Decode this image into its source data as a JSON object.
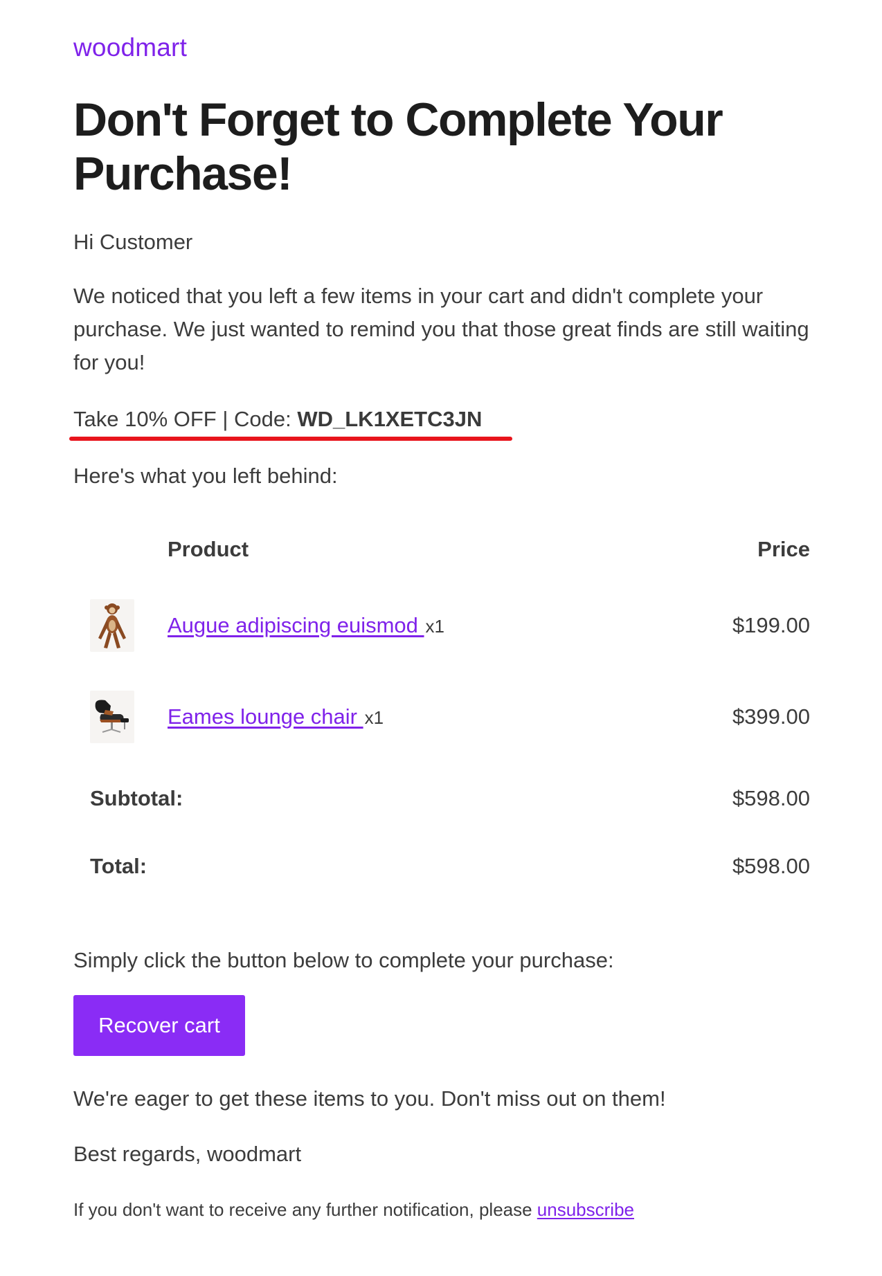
{
  "brand": {
    "name": "woodmart",
    "color": "#7f22ea"
  },
  "email": {
    "title": "Don't Forget to Complete Your Purchase!",
    "greeting": "Hi Customer",
    "intro": "We noticed that you left a few items in your cart and didn't complete your purchase. We just wanted to remind you that those great finds are still waiting for you!",
    "promo": {
      "prefix": "Take 10% OFF | Code: ",
      "code": "WD_LK1XETC3JN",
      "highlight_color": "#e8141c"
    },
    "left_behind": "Here's what you left behind:",
    "table": {
      "product_header": "Product",
      "price_header": "Price",
      "items": [
        {
          "name": "Augue adipiscing euismod ",
          "qty": "x1",
          "price": "$199.00",
          "thumb_icon": "wooden-monkey-figure-icon"
        },
        {
          "name": "Eames lounge chair ",
          "qty": "x1",
          "price": "$399.00",
          "thumb_icon": "lounge-chair-icon"
        }
      ],
      "subtotal_label": "Subtotal:",
      "subtotal_value": "$598.00",
      "total_label": "Total:",
      "total_value": "$598.00"
    },
    "cta_text": "Simply click the button below to complete your purchase:",
    "button_label": "Recover cart",
    "button_color": "#8a2cf5",
    "eager": "We're eager to get these items to you. Don't miss out on them!",
    "regards": "Best regards, woodmart",
    "footer": {
      "text": "If you don't want to receive any further notification, please ",
      "link": "unsubscribe"
    }
  }
}
